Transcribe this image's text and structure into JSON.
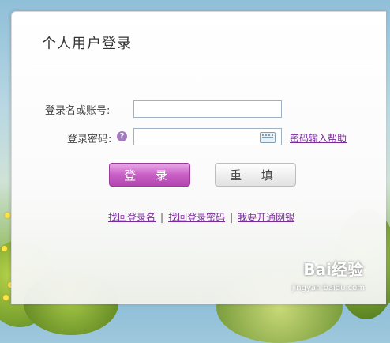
{
  "login": {
    "title": "个人用户登录",
    "username_label": "登录名或账号:",
    "password_label": "登录密码:",
    "help_icon_text": "?",
    "username_value": "",
    "password_value": "",
    "password_help_link": "密码输入帮助",
    "login_button": "登 录",
    "reset_button": "重 填"
  },
  "links": {
    "retrieve_username": "找回登录名",
    "retrieve_password": "找回登录密码",
    "open_netbank": "我要开通网银",
    "separator": "|"
  },
  "watermark": {
    "text": "Bai经验",
    "sub": "jingyan.baidu.com"
  },
  "colors": {
    "login_button": "#c860c6",
    "link": "#7a2a9a",
    "input_border": "#9db2c7"
  }
}
